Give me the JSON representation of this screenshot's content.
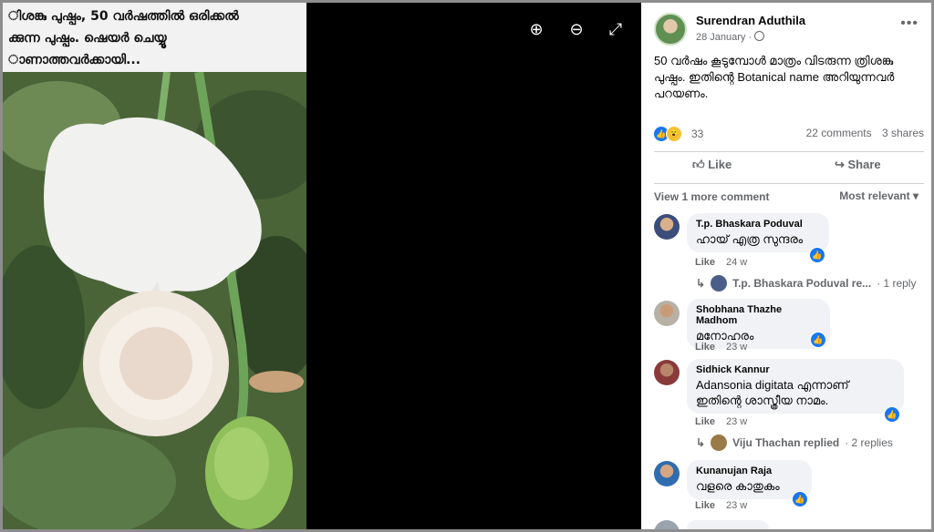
{
  "photo": {
    "caption_lines": [
      "ിശങ്കു പുഷ്പം, 50 വർഷത്തിൽ ഒരിക്കൽ",
      "ക്കുന്ന പുഷ്പം. ഷെയർ ചെയ്യൂ",
      "ാണാത്തവർക്കായി..."
    ]
  },
  "controls": {
    "zoom_in": "⊕",
    "zoom_out": "⊖",
    "fullscreen": "⤢"
  },
  "post": {
    "author": "Surendran Aduthila",
    "date": "28 January ·",
    "more": "•••",
    "text": "50 വർഷം കൂടുമ്പോൾ മാത്രം വിടരുന്ന ത്രിശങ്കു പുഷ്പം. ഇതിന്റെ Botanical name അറിയുന്നവർ പറയണം.",
    "reaction_count": "33",
    "comments": "22 comments",
    "shares": "3 shares",
    "like_label": "Like",
    "share_label": "Share"
  },
  "comments_bar": {
    "view_more": "View 1 more comment",
    "sort": "Most relevant ▾"
  },
  "comments": [
    {
      "name": "T.p. Bhaskara Poduval",
      "text": "ഹായ് എത്ര സുന്ദരം",
      "like": "Like",
      "time": "24 w",
      "reply": "T.p. Bhaskara Poduval re...",
      "reply_count": "· 1 reply"
    },
    {
      "name": "Shobhana Thazhe Madhom",
      "text": "മനോഹരം",
      "like": "Like",
      "time": "23 w"
    },
    {
      "name": "Sidhick Kannur",
      "text": "Adansonia digitata എന്നാണ് ഇതിന്റെ ശാസ്ത്രീയ നാമം.",
      "like": "Like",
      "time": "23 w",
      "reply": "Viju Thachan replied",
      "reply_count": "· 2 replies"
    },
    {
      "name": "Kunanujan Raja",
      "text": "വളരെ കാതുകം",
      "like": "Like",
      "time": "23 w"
    }
  ],
  "colors": {
    "accent": "#1877f2",
    "muted": "#65676b",
    "bubble": "#f0f2f5"
  }
}
